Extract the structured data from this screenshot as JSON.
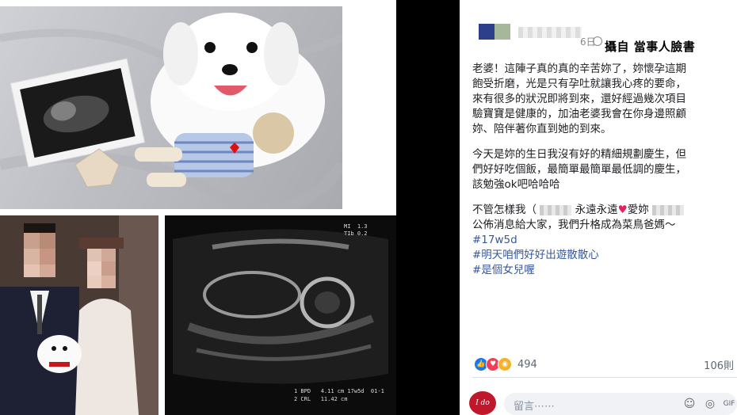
{
  "post": {
    "date": "6日",
    "caption_overlay": "攝自 當事人臉書",
    "paragraphs": [
      [
        "老婆！這陣子真的真的辛苦妳了，妳懷孕這期",
        "飽受折磨，光是只有孕吐就讓我心疼的要命，",
        "來有很多的狀況即將到來，還好經過幾次項目",
        "驗寶寶是健康的，加油老婆我會在你身邊照顧",
        "妳、陪伴著你直到她的到來。"
      ],
      [
        "今天是妳的生日我沒有好的精細規劃慶生，但",
        "們好好吃個飯，最簡單最簡單最低調的慶生，",
        "該勉強ok吧哈哈哈"
      ]
    ],
    "love_line_prefix": "不管怎樣我（",
    "love_line_mid": "永遠永遠",
    "love_line_suffix": "愛妳",
    "announce_line": "公佈消息給大家，我們升格成為菜鳥爸媽～",
    "hashtags": [
      "#17w5d",
      "#明天咱們好好出遊散散心",
      "#是個女兒喔"
    ],
    "reaction_count": "494",
    "comment_count": "106則",
    "comment_placeholder": "留言⋯⋯",
    "commenter_avatar_text": "I do"
  },
  "ultrasound": {
    "bpd_line": "1 BPD   4.11 cm 17w5d  01-1",
    "crl_line": "2 CRL   11.42 cm",
    "mi_line": "MI  1.3",
    "ti_line": "TIb 0.2"
  },
  "icons": {
    "like": "thumbs-up-icon",
    "love": "heart-icon",
    "wow": "wow-face-icon",
    "emoji": "smiley-icon",
    "camera": "camera-icon",
    "gif": "gif-icon"
  },
  "colors": {
    "hashtag": "#385898",
    "like_blue": "#1877f2",
    "love_red": "#f33e58",
    "wow_yellow": "#f7b125"
  }
}
